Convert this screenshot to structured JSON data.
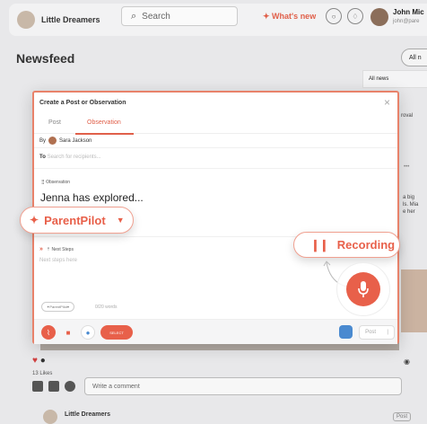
{
  "topbar": {
    "brand": "Little Dreamers",
    "search_placeholder": "Search",
    "whats_new": "What's new",
    "user_name": "John Mic",
    "user_email": "john@pare"
  },
  "feed": {
    "title": "Newsfeed",
    "filter_label": "All n",
    "all_news": "All news",
    "side_text_1": "roval",
    "side_text_2": "a big\nls. Mia\ne her",
    "likes_count": "13 Likes",
    "comment_placeholder": "Write a comment",
    "card2_name": "Little Dreamers",
    "card2_chip": "Post"
  },
  "modal": {
    "title": "Create a Post or Observation",
    "tabs": [
      "Post",
      "Observation"
    ],
    "active_tab": "Observation",
    "by_label": "By",
    "by_name": "Sara Jackson",
    "to_label": "To",
    "to_placeholder": "Search for recipients...",
    "observation_label": "Observation",
    "observation_text": "Jenna has explored...",
    "next_steps_label": "Next Steps",
    "next_steps_placeholder": "Next steps here",
    "mini_parentpilot": "ParentPilot",
    "word_count": "0/20 words",
    "select_label": "SELECT",
    "post_label": "Post"
  },
  "overlays": {
    "parentpilot_label": "ParentPilot",
    "recording_label": "Recording"
  },
  "colors": {
    "accent": "#e8604a"
  }
}
